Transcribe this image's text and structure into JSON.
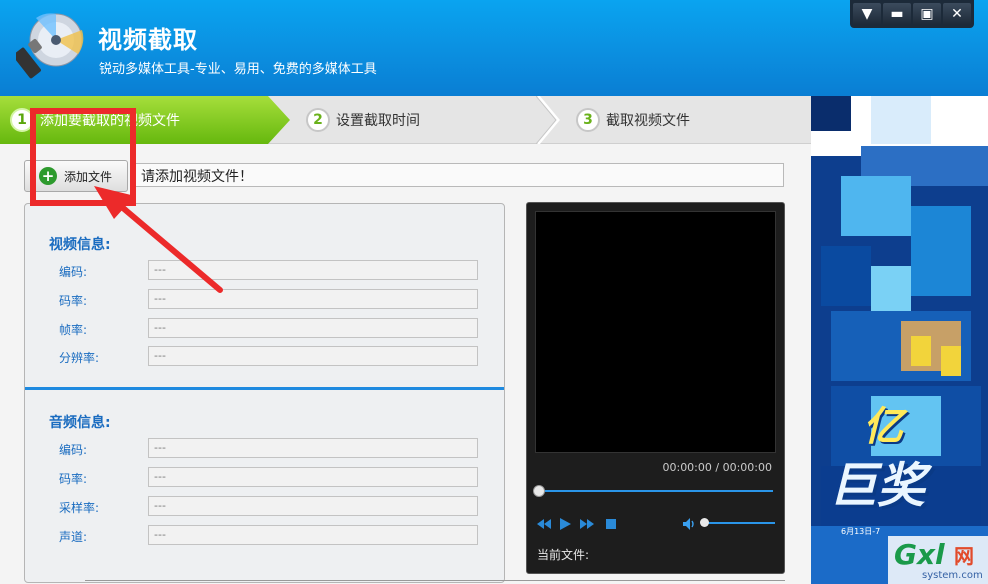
{
  "app": {
    "title": "视频截取",
    "subtitle": "锐动多媒体工具-专业、易用、免费的多媒体工具"
  },
  "window_controls": {
    "menu_icon": "triangle-down-icon",
    "minimize_icon": "minus-icon",
    "maximize_icon": "square-icon",
    "close_icon": "x-icon"
  },
  "steps": [
    {
      "num": "1",
      "label": "添加要截取的视频文件",
      "active": true
    },
    {
      "num": "2",
      "label": "设置截取时间",
      "active": false
    },
    {
      "num": "3",
      "label": "截取视频文件",
      "active": false
    }
  ],
  "add_file": {
    "button_label": "添加文件",
    "field_text": "请添加视频文件！"
  },
  "video_info": {
    "title": "视频信息:",
    "rows": [
      {
        "label": "编码:",
        "value": "---"
      },
      {
        "label": "码率:",
        "value": "---"
      },
      {
        "label": "帧率:",
        "value": "---"
      },
      {
        "label": "分辨率:",
        "value": "---"
      }
    ]
  },
  "audio_info": {
    "title": "音频信息:",
    "rows": [
      {
        "label": "编码:",
        "value": "---"
      },
      {
        "label": "码率:",
        "value": "---"
      },
      {
        "label": "采样率:",
        "value": "---"
      },
      {
        "label": "声道:",
        "value": "---"
      }
    ]
  },
  "player": {
    "timecode": "00:00:00 / 00:00:00",
    "current_file_label": "当前文件:",
    "seek_progress": 0,
    "volume_level": 0
  },
  "ad": {
    "text_big_1": "亿",
    "text_big_2": "巨奖",
    "text_small": "6月13日-7"
  },
  "watermark": {
    "main": "Gxl",
    "cn": "网",
    "sub": "system.com"
  },
  "colors": {
    "header_blue": "#0b8fe0",
    "step_active_green": "#66b80e",
    "section_title_blue": "#1a6cc0",
    "annotation_red": "#ec2a2a"
  }
}
